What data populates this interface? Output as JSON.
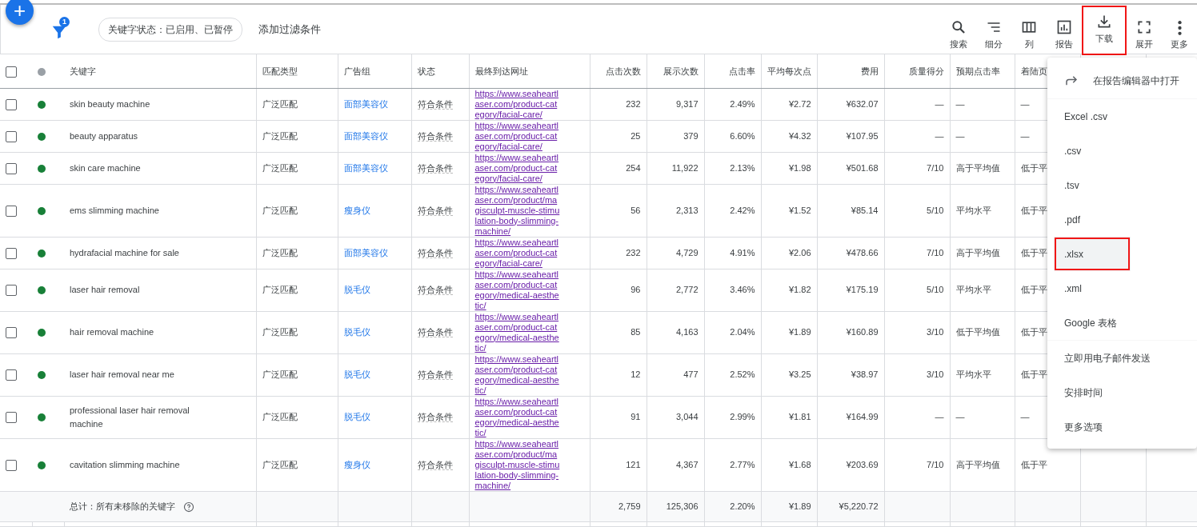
{
  "add_button": {
    "label": "+"
  },
  "filter": {
    "count": "1",
    "chip": "关键字状态：已启用、已暂停",
    "add_label": "添加过滤条件"
  },
  "toolbar": [
    {
      "kind": "search",
      "label": "搜索",
      "highlighted": false
    },
    {
      "kind": "segment",
      "label": "细分",
      "highlighted": false
    },
    {
      "kind": "columns",
      "label": "列",
      "highlighted": false
    },
    {
      "kind": "report",
      "label": "报告",
      "highlighted": false
    },
    {
      "kind": "download",
      "label": "下载",
      "highlighted": true
    },
    {
      "kind": "expand",
      "label": "展开",
      "highlighted": false
    },
    {
      "kind": "more",
      "label": "更多",
      "highlighted": false
    }
  ],
  "table": {
    "header_checked": false,
    "columns": [
      "关键字",
      "匹配类型",
      "广告组",
      "状态",
      "最终到达网址",
      "点击次数",
      "展示次数",
      "点击率",
      "平均每次点",
      "费用",
      "质量得分",
      "预期点击率",
      "着陆页"
    ],
    "rows": [
      {
        "checked": false,
        "color": "#188038",
        "keyword": "skin beauty machine",
        "match": "广泛匹配",
        "ad_group": "面部美容仪",
        "status": "符合条件",
        "url": "https://www.seaheartlaser.com/product-category/facial-care/",
        "clicks": "232",
        "impressions": "9,317",
        "ctr": "2.49%",
        "avg_cpc": "¥2.72",
        "cost": "¥632.07",
        "quality": "—",
        "expected_ctr": "—",
        "landing": "—"
      },
      {
        "checked": false,
        "color": "#188038",
        "keyword": "beauty apparatus",
        "match": "广泛匹配",
        "ad_group": "面部美容仪",
        "status": "符合条件",
        "url": "https://www.seaheartlaser.com/product-category/facial-care/",
        "clicks": "25",
        "impressions": "379",
        "ctr": "6.60%",
        "avg_cpc": "¥4.32",
        "cost": "¥107.95",
        "quality": "—",
        "expected_ctr": "—",
        "landing": "—"
      },
      {
        "checked": false,
        "color": "#188038",
        "keyword": "skin care machine",
        "match": "广泛匹配",
        "ad_group": "面部美容仪",
        "status": "符合条件",
        "url": "https://www.seaheartlaser.com/product-category/facial-care/",
        "clicks": "254",
        "impressions": "11,922",
        "ctr": "2.13%",
        "avg_cpc": "¥1.98",
        "cost": "¥501.68",
        "quality": "7/10",
        "expected_ctr": "高于平均值",
        "landing": "低于平"
      },
      {
        "checked": false,
        "color": "#188038",
        "keyword": "ems slimming machine",
        "match": "广泛匹配",
        "ad_group": "瘦身仪",
        "status": "符合条件",
        "url": "https://www.seaheartlaser.com/product/magisculpt-muscle-stimulation-body-slimming-machine/",
        "clicks": "56",
        "impressions": "2,313",
        "ctr": "2.42%",
        "avg_cpc": "¥1.52",
        "cost": "¥85.14",
        "quality": "5/10",
        "expected_ctr": "平均水平",
        "landing": "低于平"
      },
      {
        "checked": false,
        "color": "#188038",
        "keyword": "hydrafacial machine for sale",
        "match": "广泛匹配",
        "ad_group": "面部美容仪",
        "status": "符合条件",
        "url": "https://www.seaheartlaser.com/product-category/facial-care/",
        "clicks": "232",
        "impressions": "4,729",
        "ctr": "4.91%",
        "avg_cpc": "¥2.06",
        "cost": "¥478.66",
        "quality": "7/10",
        "expected_ctr": "高于平均值",
        "landing": "低于平"
      },
      {
        "checked": false,
        "color": "#188038",
        "keyword": "laser hair removal",
        "match": "广泛匹配",
        "ad_group": "脱毛仪",
        "status": "符合条件",
        "url": "https://www.seaheartlaser.com/product-category/medical-aesthetic/",
        "clicks": "96",
        "impressions": "2,772",
        "ctr": "3.46%",
        "avg_cpc": "¥1.82",
        "cost": "¥175.19",
        "quality": "5/10",
        "expected_ctr": "平均水平",
        "landing": "低于平"
      },
      {
        "checked": false,
        "color": "#188038",
        "keyword": "hair removal machine",
        "match": "广泛匹配",
        "ad_group": "脱毛仪",
        "status": "符合条件",
        "url": "https://www.seaheartlaser.com/product-category/medical-aesthetic/",
        "clicks": "85",
        "impressions": "4,163",
        "ctr": "2.04%",
        "avg_cpc": "¥1.89",
        "cost": "¥160.89",
        "quality": "3/10",
        "expected_ctr": "低于平均值",
        "landing": "低于平"
      },
      {
        "checked": false,
        "color": "#188038",
        "keyword": "laser hair removal near me",
        "match": "广泛匹配",
        "ad_group": "脱毛仪",
        "status": "符合条件",
        "url": "https://www.seaheartlaser.com/product-category/medical-aesthetic/",
        "clicks": "12",
        "impressions": "477",
        "ctr": "2.52%",
        "avg_cpc": "¥3.25",
        "cost": "¥38.97",
        "quality": "3/10",
        "expected_ctr": "平均水平",
        "landing": "低于平"
      },
      {
        "checked": false,
        "color": "#188038",
        "keyword": "professional laser hair removal machine",
        "match": "广泛匹配",
        "ad_group": "脱毛仪",
        "status": "符合条件",
        "url": "https://www.seaheartlaser.com/product-category/medical-aesthetic/",
        "clicks": "91",
        "impressions": "3,044",
        "ctr": "2.99%",
        "avg_cpc": "¥1.81",
        "cost": "¥164.99",
        "quality": "—",
        "expected_ctr": "—",
        "landing": "—"
      },
      {
        "checked": false,
        "color": "#188038",
        "keyword": "cavitation slimming machine",
        "match": "广泛匹配",
        "ad_group": "瘦身仪",
        "status": "符合条件",
        "url": "https://www.seaheartlaser.com/product/magisculpt-muscle-stimulation-body-slimming-machine/",
        "clicks": "121",
        "impressions": "4,367",
        "ctr": "2.77%",
        "avg_cpc": "¥1.68",
        "cost": "¥203.69",
        "quality": "7/10",
        "expected_ctr": "高于平均值",
        "landing": "低于平"
      }
    ],
    "total": {
      "label": "总计：所有未移除的关键字",
      "clicks": "2,759",
      "impressions": "125,306",
      "ctr": "2.20%",
      "avg_cpc": "¥1.89",
      "cost": "¥5,220.72"
    }
  },
  "download_menu": [
    {
      "kind": "open",
      "label": "在报告编辑器中打开",
      "highlighted": false
    },
    {
      "kind": "divider"
    },
    {
      "kind": "item",
      "label": "Excel .csv",
      "highlighted": false
    },
    {
      "kind": "item",
      "label": ".csv",
      "highlighted": false
    },
    {
      "kind": "item",
      "label": ".tsv",
      "highlighted": false
    },
    {
      "kind": "item",
      "label": ".pdf",
      "highlighted": false
    },
    {
      "kind": "item",
      "label": ".xlsx",
      "highlighted": true
    },
    {
      "kind": "item",
      "label": ".xml",
      "highlighted": false
    },
    {
      "kind": "item",
      "label": "Google 表格",
      "highlighted": false
    },
    {
      "kind": "divider"
    },
    {
      "kind": "item",
      "label": "立即用电子邮件发送",
      "highlighted": false
    },
    {
      "kind": "item",
      "label": "安排时间",
      "highlighted": false
    },
    {
      "kind": "item",
      "label": "更多选项",
      "highlighted": false
    }
  ]
}
